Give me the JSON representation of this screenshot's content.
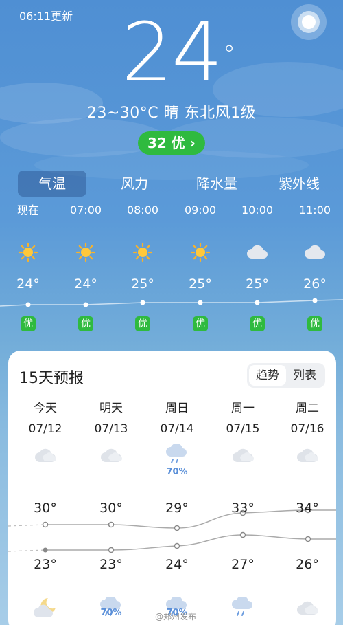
{
  "header": {
    "update_time": "06:11更新",
    "current_temp": "24",
    "degree_symbol": "°",
    "condition_line": "23~30°C 晴 东北风1级",
    "aqi_label": "32 优 ›"
  },
  "tabs": [
    {
      "label": "气温",
      "active": true
    },
    {
      "label": "风力",
      "active": false
    },
    {
      "label": "降水量",
      "active": false
    },
    {
      "label": "紫外线",
      "active": false
    }
  ],
  "hourly": [
    {
      "time": "现在",
      "icon": "sun-icon",
      "temp": "24°",
      "aqi": "优"
    },
    {
      "time": "07:00",
      "icon": "sun-icon",
      "temp": "24°",
      "aqi": "优"
    },
    {
      "time": "08:00",
      "icon": "sun-icon",
      "temp": "25°",
      "aqi": "优"
    },
    {
      "time": "09:00",
      "icon": "sun-icon",
      "temp": "25°",
      "aqi": "优"
    },
    {
      "time": "10:00",
      "icon": "cloud-icon",
      "temp": "25°",
      "aqi": "优"
    },
    {
      "time": "11:00",
      "icon": "cloud-icon",
      "temp": "26°",
      "aqi": "优"
    }
  ],
  "forecast": {
    "title": "15天预报",
    "toggle": {
      "trend": "趋势",
      "list": "列表",
      "active": "趋势"
    },
    "days": [
      {
        "name": "今天",
        "date": "07/12",
        "day_icon": "cloud-icon",
        "day_precip": "",
        "high": "30°",
        "low": "23°",
        "night_icon": "moon-cloud-icon",
        "night_precip": ""
      },
      {
        "name": "明天",
        "date": "07/13",
        "day_icon": "cloud-icon",
        "day_precip": "",
        "high": "30°",
        "low": "23°",
        "night_icon": "rain-cloud-icon",
        "night_precip": "70%"
      },
      {
        "name": "周日",
        "date": "07/14",
        "day_icon": "rain-cloud-icon",
        "day_precip": "70%",
        "high": "29°",
        "low": "24°",
        "night_icon": "rain-cloud-icon",
        "night_precip": "70%"
      },
      {
        "name": "周一",
        "date": "07/15",
        "day_icon": "cloud-icon",
        "day_precip": "",
        "high": "33°",
        "low": "27°",
        "night_icon": "rain-cloud-icon",
        "night_precip": ""
      },
      {
        "name": "周二",
        "date": "07/16",
        "day_icon": "cloud-icon",
        "day_precip": "",
        "high": "34°",
        "low": "26°",
        "night_icon": "cloud-icon",
        "night_precip": ""
      }
    ]
  },
  "colors": {
    "aqi_good": "#2fba3f",
    "precip": "#5a8fd8",
    "sky_top": "#4f8fd3"
  },
  "watermark": "@郑州发布"
}
